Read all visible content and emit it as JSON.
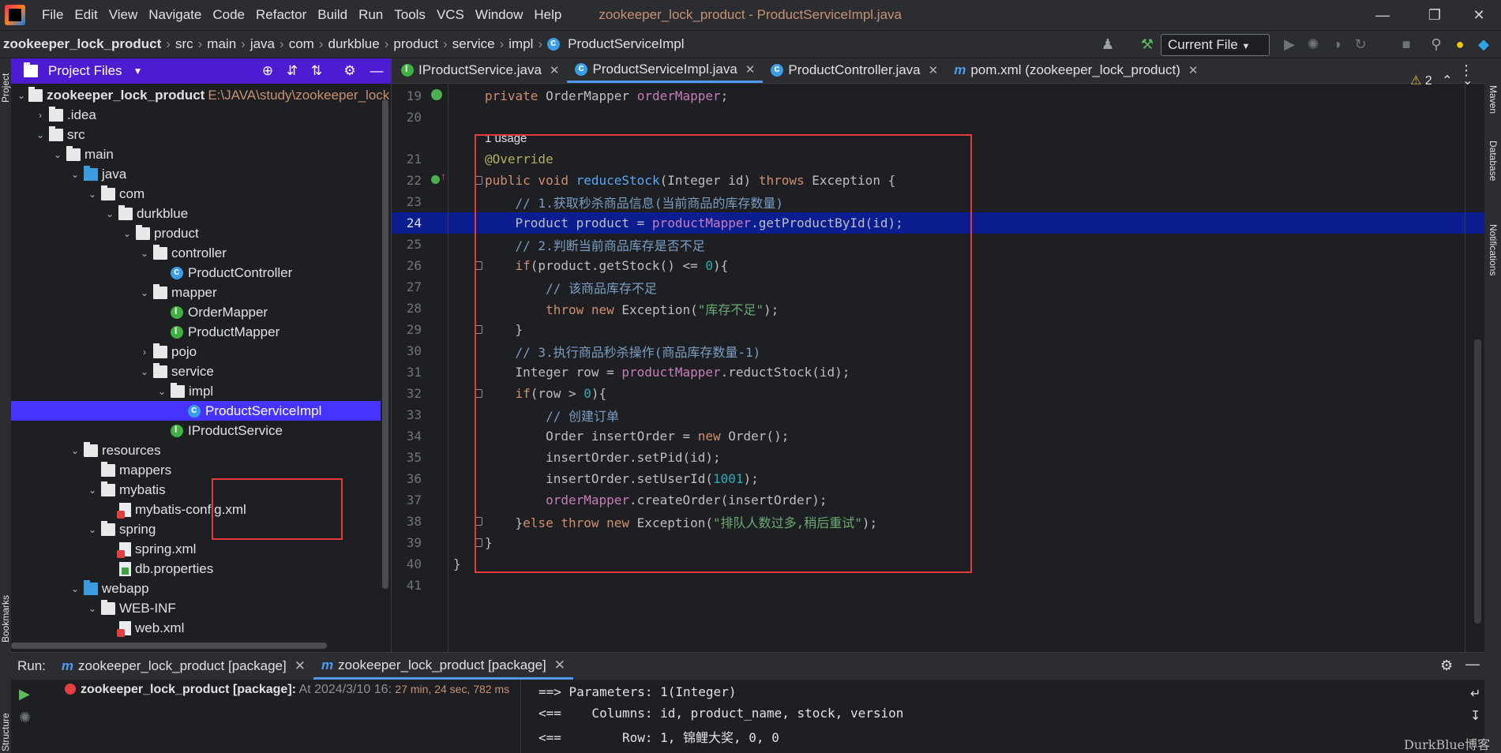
{
  "menubar": {
    "items": [
      "File",
      "Edit",
      "View",
      "Navigate",
      "Code",
      "Refactor",
      "Build",
      "Run",
      "Tools",
      "VCS",
      "Window",
      "Help"
    ],
    "window_title": "zookeeper_lock_product - ProductServiceImpl.java"
  },
  "navbar": {
    "crumbs": [
      "zookeeper_lock_product",
      "src",
      "main",
      "java",
      "com",
      "durkblue",
      "product",
      "service",
      "impl",
      "ProductServiceImpl"
    ],
    "run_config": "Current File"
  },
  "project": {
    "title": "Project Files",
    "root_name": "zookeeper_lock_product",
    "root_path": "E:\\JAVA\\study\\zookeeper_lock",
    "tree": [
      {
        "label": ".idea"
      },
      {
        "label": "src"
      },
      {
        "label": "main"
      },
      {
        "label": "java"
      },
      {
        "label": "com"
      },
      {
        "label": "durkblue"
      },
      {
        "label": "product"
      },
      {
        "label": "controller"
      },
      {
        "label": "ProductController"
      },
      {
        "label": "mapper"
      },
      {
        "label": "OrderMapper"
      },
      {
        "label": "ProductMapper"
      },
      {
        "label": "pojo"
      },
      {
        "label": "service"
      },
      {
        "label": "impl"
      },
      {
        "label": "ProductServiceImpl"
      },
      {
        "label": "IProductService"
      },
      {
        "label": "resources"
      },
      {
        "label": "mappers"
      },
      {
        "label": "mybatis"
      },
      {
        "label": "mybatis-config.xml"
      },
      {
        "label": "spring"
      },
      {
        "label": "spring.xml"
      },
      {
        "label": "db.properties"
      },
      {
        "label": "webapp"
      },
      {
        "label": "WEB-INF"
      },
      {
        "label": "web.xml"
      }
    ]
  },
  "editor": {
    "tabs": [
      "IProductService.java",
      "ProductServiceImpl.java",
      "ProductController.java",
      "pom.xml (zookeeper_lock_product)"
    ],
    "active_tab": "ProductServiceImpl.java",
    "warnings_count": "2",
    "usage_hint": "1 usage",
    "line_numbers": [
      "19",
      "20",
      "21",
      "22",
      "23",
      "24",
      "25",
      "26",
      "27",
      "28",
      "29",
      "30",
      "31",
      "32",
      "33",
      "34",
      "35",
      "36",
      "37",
      "38",
      "39",
      "40",
      "41"
    ],
    "code": {
      "l19": [
        "private",
        "OrderMapper",
        "orderMapper",
        ";"
      ],
      "l21": "@Override",
      "l22": [
        "public void",
        "reduceStock",
        "(Integer id)",
        "throws",
        "Exception {"
      ],
      "l23": "// 1.获取秒杀商品信息(当前商品的库存数量)",
      "l24": [
        "Product product = ",
        "productMapper",
        ".getProductById(id);"
      ],
      "l25": "// 2.判断当前商品库存是否不足",
      "l26": [
        "if",
        "(product.getStock() <= ",
        "0",
        "){"
      ],
      "l27": "// 该商品库存不足",
      "l28": [
        "throw new",
        "Exception(",
        "\"库存不足\"",
        ");"
      ],
      "l29": "}",
      "l30": "// 3.执行商品秒杀操作(商品库存数量-1)",
      "l31": [
        "Integer row = ",
        "productMapper",
        ".reductStock(id);"
      ],
      "l32": [
        "if",
        "(row > ",
        "0",
        "){"
      ],
      "l33": "// 创建订单",
      "l34": [
        "Order insertOrder = ",
        "new",
        "Order();"
      ],
      "l35": "insertOrder.setPid(id);",
      "l36": [
        "insertOrder.setUserId(",
        "1001",
        ");"
      ],
      "l37": [
        "orderMapper",
        ".createOrder(insertOrder);"
      ],
      "l38": [
        "}",
        "else throw new",
        "Exception(",
        "\"排队人数过多,稍后重试\"",
        ");"
      ],
      "l39": "}",
      "l40": "}"
    }
  },
  "run": {
    "label": "Run:",
    "tabs": [
      "zookeeper_lock_product [package]",
      "zookeeper_lock_product [package]"
    ],
    "task_name": "zookeeper_lock_product [package]:",
    "task_time": "At 2024/3/10 16:",
    "task_duration": "27 min, 24 sec, 782 ms",
    "console": [
      "==> Parameters: 1(Integer)",
      "<==    Columns: id, product_name, stock, version",
      "<==        Row: 1, 锦鲤大奖, 0, 0"
    ]
  },
  "stripes": {
    "left": [
      "Project",
      "Bookmarks",
      "Structure"
    ],
    "right": [
      "Maven",
      "Database",
      "Notifications"
    ]
  },
  "watermark": "DurkBlue博客"
}
